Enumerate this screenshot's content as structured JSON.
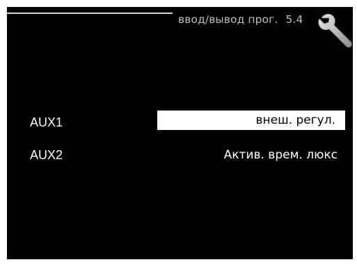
{
  "header": {
    "title": "ввод/вывод прог.",
    "menu_number": "5.4",
    "icon": "wrench-icon"
  },
  "rows": [
    {
      "label": "AUX1",
      "value": "внеш. регул.",
      "selected": true
    },
    {
      "label": "AUX2",
      "value": "Актив. врем. люкс",
      "selected": false
    }
  ],
  "colors": {
    "background": "#000000",
    "text": "#ffffff",
    "title": "#bdbdbd",
    "selection_bg": "#ffffff",
    "selection_text": "#000000"
  }
}
